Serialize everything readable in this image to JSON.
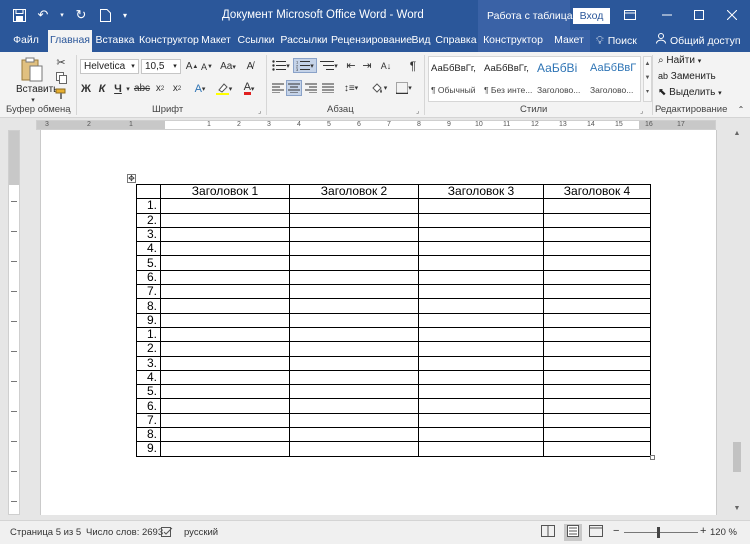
{
  "titlebar": {
    "document_title": "Документ Microsoft Office Word  -  Word",
    "context_title": "Работа с таблицами",
    "login_label": "Вход"
  },
  "tabs": [
    "Файл",
    "Главная",
    "Вставка",
    "Конструктор",
    "Макет",
    "Ссылки",
    "Рассылки",
    "Рецензирование",
    "Вид",
    "Справка",
    "Конструктор",
    "Макет"
  ],
  "tabs_right": {
    "search_label": "Поиск",
    "share_label": "Общий доступ"
  },
  "ribbon": {
    "clipboard": {
      "paste_label": "Вставить",
      "group_label": "Буфер обмена"
    },
    "font": {
      "font_name": "Helvetica",
      "font_size": "10,5",
      "group_label": "Шрифт",
      "bold": "Ж",
      "italic": "К",
      "underline": "Ч",
      "case_label": "Aa"
    },
    "paragraph": {
      "group_label": "Абзац"
    },
    "styles": {
      "group_label": "Стили",
      "items": [
        {
          "sample": "АаБбВвГг,",
          "name": "¶ Обычный"
        },
        {
          "sample": "АаБбВвГг,",
          "name": "¶ Без инте..."
        },
        {
          "sample": "АаБбВі",
          "name": "Заголово..."
        },
        {
          "sample": "АаБбВвГ",
          "name": "Заголово..."
        }
      ]
    },
    "editing": {
      "group_label": "Редактирование",
      "find": "Найти",
      "replace": "Заменить",
      "select": "Выделить"
    }
  },
  "ruler": {
    "numbers": [
      "3",
      "2",
      "1",
      "1",
      "2",
      "3",
      "4",
      "5",
      "6",
      "7",
      "8",
      "9",
      "10",
      "11",
      "12",
      "13",
      "14",
      "15",
      "16",
      "17"
    ]
  },
  "table": {
    "headers": [
      "",
      "Заголовок 1",
      "Заголовок 2",
      "Заголовок 3",
      "Заголовок 4"
    ],
    "rows": [
      "1.",
      "2.",
      "3.",
      "4.",
      "5.",
      "6.",
      "7.",
      "8.",
      "9.",
      "1.",
      "2.",
      "3.",
      "4.",
      "5.",
      "6.",
      "7.",
      "8.",
      "9."
    ]
  },
  "statusbar": {
    "page": "Страница 5 из 5",
    "words": "Число слов: 2693",
    "language": "русский",
    "zoom": "120 %"
  }
}
